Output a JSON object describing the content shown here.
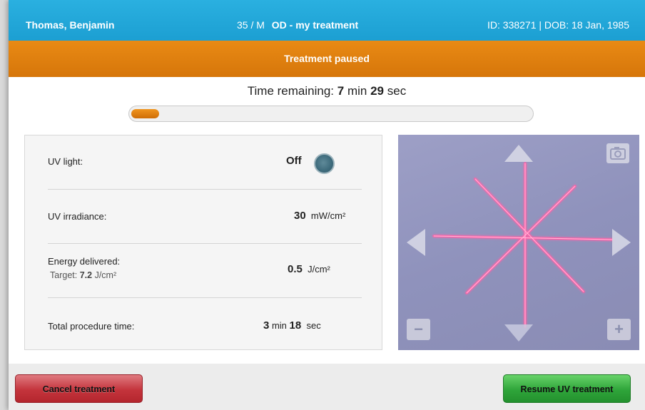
{
  "header": {
    "patient_name": "Thomas, Benjamin",
    "age_sex": "35 / M",
    "treatment_name": "OD - my treatment",
    "patient_id_dob": "ID: 338271 | DOB: 18 Jan, 1985"
  },
  "status": {
    "text": "Treatment paused",
    "color": "#e08312"
  },
  "timer": {
    "prefix": "Time remaining:",
    "minutes": "7",
    "min_unit": "min",
    "seconds": "29",
    "sec_unit": "sec",
    "progress_percent": 7
  },
  "metrics": {
    "uv_light": {
      "label": "UV light:",
      "value": "Off",
      "indicator_icon": "uv-status-indicator"
    },
    "uv_irradiance": {
      "label": "UV irradiance:",
      "value": "30",
      "unit": "mW/cm²"
    },
    "energy_delivered": {
      "label": "Energy delivered:",
      "target_prefix": "Target:",
      "target_value": "7.2",
      "target_unit": "J/cm²",
      "value": "0.5",
      "unit": "J/cm²"
    },
    "total_procedure_time": {
      "label": "Total procedure time:",
      "minutes": "3",
      "min_unit": "min",
      "seconds": "18",
      "sec_unit": "sec"
    }
  },
  "camera": {
    "icons": [
      "camera-icon",
      "arrow-up-icon",
      "arrow-down-icon",
      "arrow-left-icon",
      "arrow-right-icon",
      "zoom-out-icon",
      "zoom-in-icon"
    ],
    "zoom_out_label": "−",
    "zoom_in_label": "+",
    "laser_color": "#ff6fb0"
  },
  "footer": {
    "cancel_label": "Cancel treatment",
    "resume_label": "Resume UV treatment",
    "cancel_color": "#c4343c",
    "resume_color": "#2fa53a"
  },
  "colors": {
    "header_blue": "#1fa5d8",
    "accent_orange": "#e08312"
  }
}
